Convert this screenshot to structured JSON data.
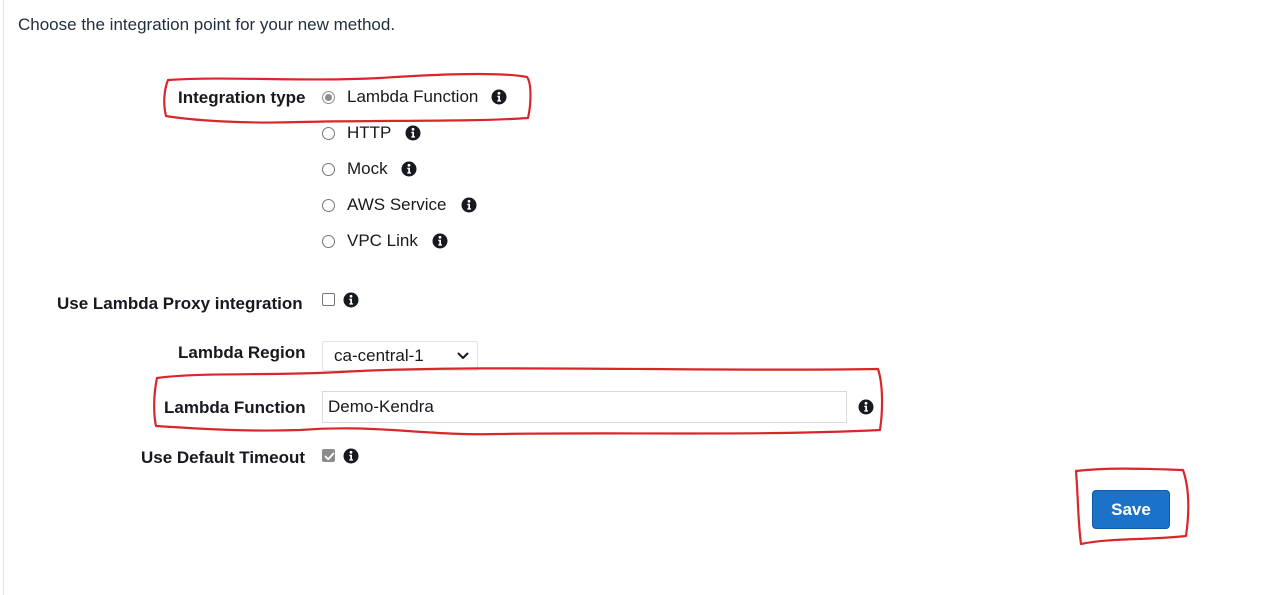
{
  "intro_text": "Choose the integration point for your new method.",
  "integration_type": {
    "label": "Integration type",
    "options": [
      {
        "label": "Lambda Function",
        "selected": true
      },
      {
        "label": "HTTP",
        "selected": false
      },
      {
        "label": "Mock",
        "selected": false
      },
      {
        "label": "AWS Service",
        "selected": false
      },
      {
        "label": "VPC Link",
        "selected": false
      }
    ]
  },
  "lambda_proxy": {
    "label": "Use Lambda Proxy integration",
    "checked": false
  },
  "lambda_region": {
    "label": "Lambda Region",
    "value": "ca-central-1"
  },
  "lambda_function": {
    "label": "Lambda Function",
    "value": "Demo-Kendra"
  },
  "default_timeout": {
    "label": "Use Default Timeout",
    "checked": true
  },
  "save_label": "Save",
  "colors": {
    "accent": "#1a73c8",
    "annotation": "#d8262b"
  },
  "icons": {
    "info": "info-icon",
    "dropdown": "chevron-down-icon",
    "check": "check-icon"
  }
}
